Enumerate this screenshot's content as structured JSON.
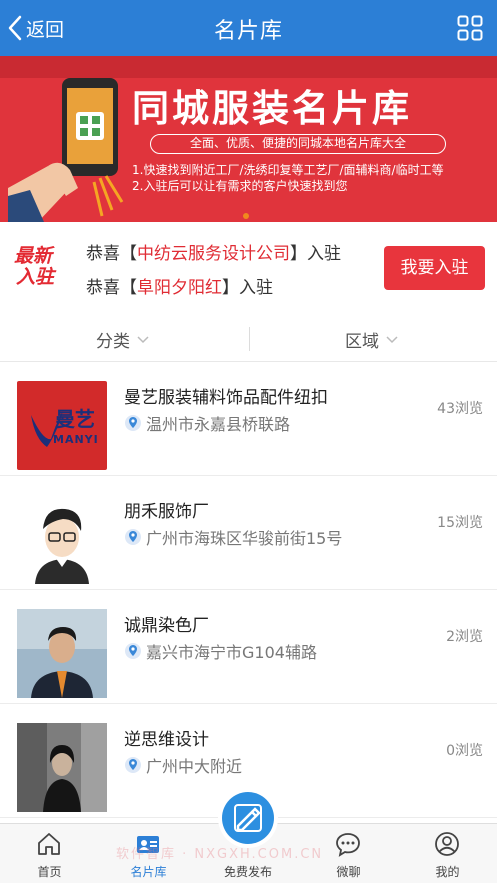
{
  "header": {
    "back_label": "返回",
    "title": "名片库"
  },
  "banner": {
    "title": "同城服装名片库",
    "pill": "全面、优质、便捷的同城本地名片库大全",
    "line1": "1.快速找到附近工厂/洗绣印复等工艺厂/面辅料商/临时工等",
    "line2": "2.入驻后可以让有需求的客户快速找到您"
  },
  "new_entry": {
    "logo_top": "最新",
    "logo_bottom": "入驻",
    "items": [
      {
        "prefix": "恭喜【",
        "company": "中纺云服务设计公司",
        "suffix": "】入驻"
      },
      {
        "prefix": "恭喜【",
        "company": "阜阳夕阳红",
        "suffix": "】入驻"
      }
    ],
    "join_label": "我要入驻"
  },
  "filters": {
    "category": "分类",
    "region": "区域"
  },
  "cards": [
    {
      "title": "曼艺服装辅料饰品配件纽扣",
      "location": "温州市永嘉县桥联路",
      "views": "43浏览",
      "thumb_text": "曼艺",
      "thumb_sub": "MANYI"
    },
    {
      "title": "朋禾服饰厂",
      "location": "广州市海珠区华骏前街15号",
      "views": "15浏览"
    },
    {
      "title": "诚鼎染色厂",
      "location": "嘉兴市海宁市G104辅路",
      "views": "2浏览"
    },
    {
      "title": "逆思维设计",
      "location": "广州中大附近",
      "views": "0浏览"
    }
  ],
  "tabbar": {
    "home": "首页",
    "cards": "名片库",
    "publish": "免费发布",
    "chat": "微聊",
    "mine": "我的"
  },
  "watermark": "软件智库 · NXGXH.COM.CN",
  "colors": {
    "primary": "#2c7fd6",
    "banner_red": "#e0343c",
    "accent_red": "#e8353d"
  }
}
